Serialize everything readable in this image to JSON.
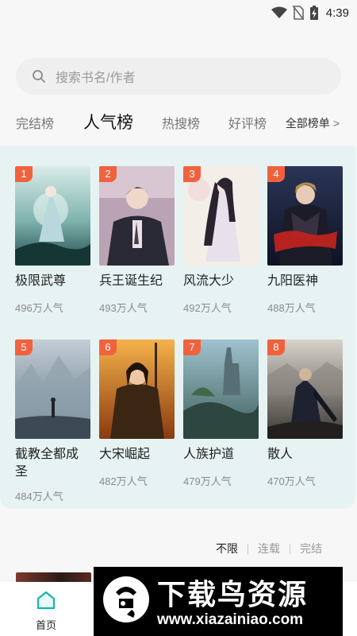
{
  "status_bar": {
    "time": "4:39",
    "icons": [
      "wifi-icon",
      "no-sim-icon",
      "battery-charging-icon"
    ]
  },
  "search": {
    "placeholder": "搜索书名/作者",
    "icon": "search-icon"
  },
  "tabs": [
    {
      "label": "完结榜",
      "active": false
    },
    {
      "label": "人气榜",
      "active": true
    },
    {
      "label": "热搜榜",
      "active": false
    },
    {
      "label": "好评榜",
      "active": false
    }
  ],
  "all_lists": {
    "label": "全部榜单",
    "icon": "chevron-right-icon"
  },
  "books": [
    {
      "rank": "1",
      "title": "极限武尊",
      "popularity": "496万人气"
    },
    {
      "rank": "2",
      "title": "兵王诞生纪",
      "popularity": "493万人气"
    },
    {
      "rank": "3",
      "title": "风流大少",
      "popularity": "492万人气"
    },
    {
      "rank": "4",
      "title": "九阳医神",
      "popularity": "488万人气"
    },
    {
      "rank": "5",
      "title": "截教全都成圣",
      "popularity": "484万人气"
    },
    {
      "rank": "6",
      "title": "大宋崛起",
      "popularity": "482万人气"
    },
    {
      "rank": "7",
      "title": "人族护道",
      "popularity": "479万人气"
    },
    {
      "rank": "8",
      "title": "散人",
      "popularity": "470万人气"
    }
  ],
  "filter": {
    "options": [
      "不限",
      "连载",
      "完结"
    ],
    "selected": "不限"
  },
  "bottom_nav": {
    "home_label": "首页",
    "home_icon": "home-icon"
  },
  "watermark": {
    "text": "下载鸟资源",
    "url": "www.xiazainiao.com"
  },
  "colors": {
    "rank_badge": "#f0623e",
    "panel_bg": "#e7f3f3",
    "home_icon": "#1ab5a8"
  }
}
